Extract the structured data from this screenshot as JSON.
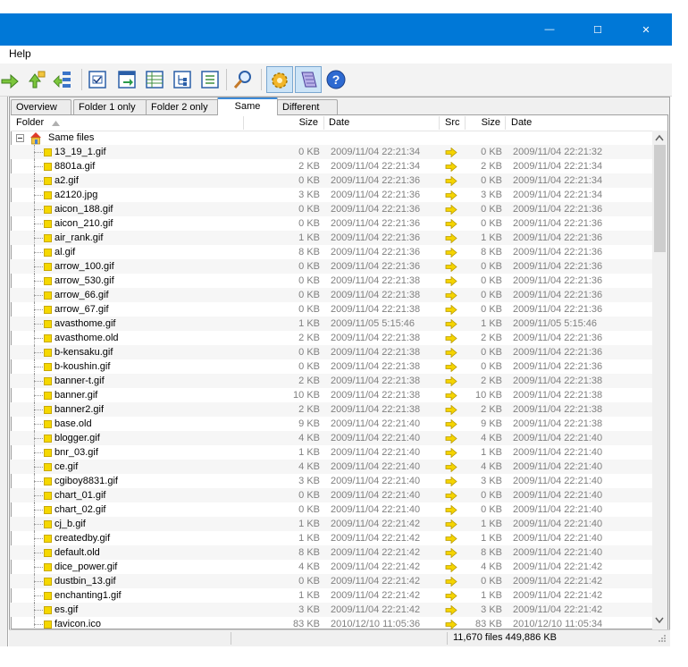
{
  "window": {
    "minimize_glyph": "—",
    "maximize_glyph": "☐",
    "close_glyph": "✕"
  },
  "menu": {
    "items": [
      "Help"
    ]
  },
  "toolbar": {
    "icons": [
      "copy-right-icon",
      "copy-left-icon",
      "sync-tree-icon",
      "check-list-icon",
      "export-icon",
      "table-icon",
      "tree-view-icon",
      "details-icon",
      "find-icon",
      "compare-gear-icon",
      "notes-icon",
      "help-icon"
    ]
  },
  "tabs": [
    "Overview",
    "Folder 1 only",
    "Folder 2 only",
    "Same",
    "Different"
  ],
  "active_tab": "Same",
  "columns": {
    "folder": "Folder",
    "size": "Size",
    "date": "Date",
    "src": "Src",
    "size2": "Size",
    "date2": "Date"
  },
  "root": {
    "label": "Same files"
  },
  "rows": [
    {
      "name": "13_19_1.gif",
      "size": "0 KB",
      "date": "2009/11/04 22:21:34",
      "size2": "0 KB",
      "date2": "2009/11/04 22:21:32"
    },
    {
      "name": "8801a.gif",
      "size": "2 KB",
      "date": "2009/11/04 22:21:34",
      "size2": "2 KB",
      "date2": "2009/11/04 22:21:34"
    },
    {
      "name": "a2.gif",
      "size": "0 KB",
      "date": "2009/11/04 22:21:36",
      "size2": "0 KB",
      "date2": "2009/11/04 22:21:34"
    },
    {
      "name": "a2120.jpg",
      "size": "3 KB",
      "date": "2009/11/04 22:21:36",
      "size2": "3 KB",
      "date2": "2009/11/04 22:21:34"
    },
    {
      "name": "aicon_188.gif",
      "size": "0 KB",
      "date": "2009/11/04 22:21:36",
      "size2": "0 KB",
      "date2": "2009/11/04 22:21:36"
    },
    {
      "name": "aicon_210.gif",
      "size": "0 KB",
      "date": "2009/11/04 22:21:36",
      "size2": "0 KB",
      "date2": "2009/11/04 22:21:36"
    },
    {
      "name": "air_rank.gif",
      "size": "1 KB",
      "date": "2009/11/04 22:21:36",
      "size2": "1 KB",
      "date2": "2009/11/04 22:21:36"
    },
    {
      "name": "al.gif",
      "size": "8 KB",
      "date": "2009/11/04 22:21:36",
      "size2": "8 KB",
      "date2": "2009/11/04 22:21:36"
    },
    {
      "name": "arrow_100.gif",
      "size": "0 KB",
      "date": "2009/11/04 22:21:36",
      "size2": "0 KB",
      "date2": "2009/11/04 22:21:36"
    },
    {
      "name": "arrow_530.gif",
      "size": "0 KB",
      "date": "2009/11/04 22:21:38",
      "size2": "0 KB",
      "date2": "2009/11/04 22:21:36"
    },
    {
      "name": "arrow_66.gif",
      "size": "0 KB",
      "date": "2009/11/04 22:21:38",
      "size2": "0 KB",
      "date2": "2009/11/04 22:21:36"
    },
    {
      "name": "arrow_67.gif",
      "size": "0 KB",
      "date": "2009/11/04 22:21:38",
      "size2": "0 KB",
      "date2": "2009/11/04 22:21:36"
    },
    {
      "name": "avasthome.gif",
      "size": "1 KB",
      "date": "2009/11/05 5:15:46",
      "size2": "1 KB",
      "date2": "2009/11/05 5:15:46"
    },
    {
      "name": "avasthome.old",
      "size": "2 KB",
      "date": "2009/11/04 22:21:38",
      "size2": "2 KB",
      "date2": "2009/11/04 22:21:36"
    },
    {
      "name": "b-kensaku.gif",
      "size": "0 KB",
      "date": "2009/11/04 22:21:38",
      "size2": "0 KB",
      "date2": "2009/11/04 22:21:36"
    },
    {
      "name": "b-koushin.gif",
      "size": "0 KB",
      "date": "2009/11/04 22:21:38",
      "size2": "0 KB",
      "date2": "2009/11/04 22:21:36"
    },
    {
      "name": "banner-t.gif",
      "size": "2 KB",
      "date": "2009/11/04 22:21:38",
      "size2": "2 KB",
      "date2": "2009/11/04 22:21:38"
    },
    {
      "name": "banner.gif",
      "size": "10 KB",
      "date": "2009/11/04 22:21:38",
      "size2": "10 KB",
      "date2": "2009/11/04 22:21:38"
    },
    {
      "name": "banner2.gif",
      "size": "2 KB",
      "date": "2009/11/04 22:21:38",
      "size2": "2 KB",
      "date2": "2009/11/04 22:21:38"
    },
    {
      "name": "base.old",
      "size": "9 KB",
      "date": "2009/11/04 22:21:40",
      "size2": "9 KB",
      "date2": "2009/11/04 22:21:38"
    },
    {
      "name": "blogger.gif",
      "size": "4 KB",
      "date": "2009/11/04 22:21:40",
      "size2": "4 KB",
      "date2": "2009/11/04 22:21:40"
    },
    {
      "name": "bnr_03.gif",
      "size": "1 KB",
      "date": "2009/11/04 22:21:40",
      "size2": "1 KB",
      "date2": "2009/11/04 22:21:40"
    },
    {
      "name": "ce.gif",
      "size": "4 KB",
      "date": "2009/11/04 22:21:40",
      "size2": "4 KB",
      "date2": "2009/11/04 22:21:40"
    },
    {
      "name": "cgiboy8831.gif",
      "size": "3 KB",
      "date": "2009/11/04 22:21:40",
      "size2": "3 KB",
      "date2": "2009/11/04 22:21:40"
    },
    {
      "name": "chart_01.gif",
      "size": "0 KB",
      "date": "2009/11/04 22:21:40",
      "size2": "0 KB",
      "date2": "2009/11/04 22:21:40"
    },
    {
      "name": "chart_02.gif",
      "size": "0 KB",
      "date": "2009/11/04 22:21:40",
      "size2": "0 KB",
      "date2": "2009/11/04 22:21:40"
    },
    {
      "name": "cj_b.gif",
      "size": "1 KB",
      "date": "2009/11/04 22:21:42",
      "size2": "1 KB",
      "date2": "2009/11/04 22:21:40"
    },
    {
      "name": "createdby.gif",
      "size": "1 KB",
      "date": "2009/11/04 22:21:42",
      "size2": "1 KB",
      "date2": "2009/11/04 22:21:40"
    },
    {
      "name": "default.old",
      "size": "8 KB",
      "date": "2009/11/04 22:21:42",
      "size2": "8 KB",
      "date2": "2009/11/04 22:21:40"
    },
    {
      "name": "dice_power.gif",
      "size": "4 KB",
      "date": "2009/11/04 22:21:42",
      "size2": "4 KB",
      "date2": "2009/11/04 22:21:42"
    },
    {
      "name": "dustbin_13.gif",
      "size": "0 KB",
      "date": "2009/11/04 22:21:42",
      "size2": "0 KB",
      "date2": "2009/11/04 22:21:42"
    },
    {
      "name": "enchanting1.gif",
      "size": "1 KB",
      "date": "2009/11/04 22:21:42",
      "size2": "1 KB",
      "date2": "2009/11/04 22:21:42"
    },
    {
      "name": "es.gif",
      "size": "3 KB",
      "date": "2009/11/04 22:21:42",
      "size2": "3 KB",
      "date2": "2009/11/04 22:21:42"
    },
    {
      "name": "favicon.ico",
      "size": "83 KB",
      "date": "2010/12/10 11:05:36",
      "size2": "83 KB",
      "date2": "2010/12/10 11:05:34"
    }
  ],
  "status": {
    "summary": "11,670 files 449,886 KB"
  }
}
